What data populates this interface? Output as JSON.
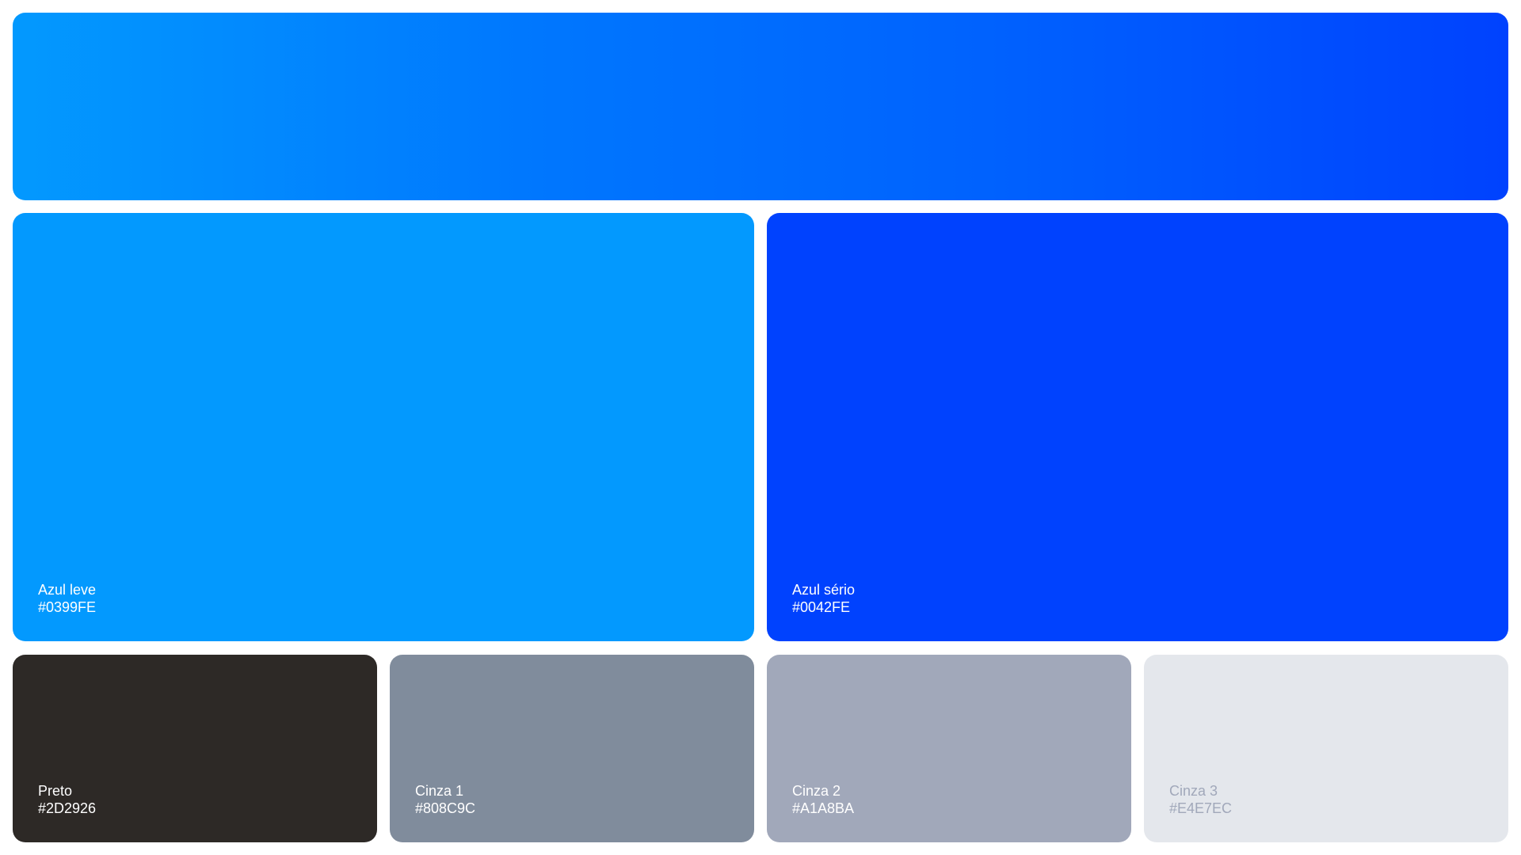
{
  "palette": {
    "gradient": {
      "from": "#0399FE",
      "to": "#0042FE"
    },
    "swatches": [
      {
        "name": "Azul leve",
        "hex": "#0399FE",
        "color": "#0399FE",
        "text_color": "#ffffff"
      },
      {
        "name": "Azul sério",
        "hex": "#0042FE",
        "color": "#0042FE",
        "text_color": "#ffffff"
      },
      {
        "name": "Preto",
        "hex": "#2D2926",
        "color": "#2D2926",
        "text_color": "#ffffff"
      },
      {
        "name": "Cinza 1",
        "hex": "#808C9C",
        "color": "#808C9C",
        "text_color": "#ffffff"
      },
      {
        "name": "Cinza 2",
        "hex": "#A1A8BA",
        "color": "#A1A8BA",
        "text_color": "#ffffff"
      },
      {
        "name": "Cinza 3",
        "hex": "#E4E7EC",
        "color": "#E4E7EC",
        "text_color": "#A1A8BA"
      }
    ]
  }
}
